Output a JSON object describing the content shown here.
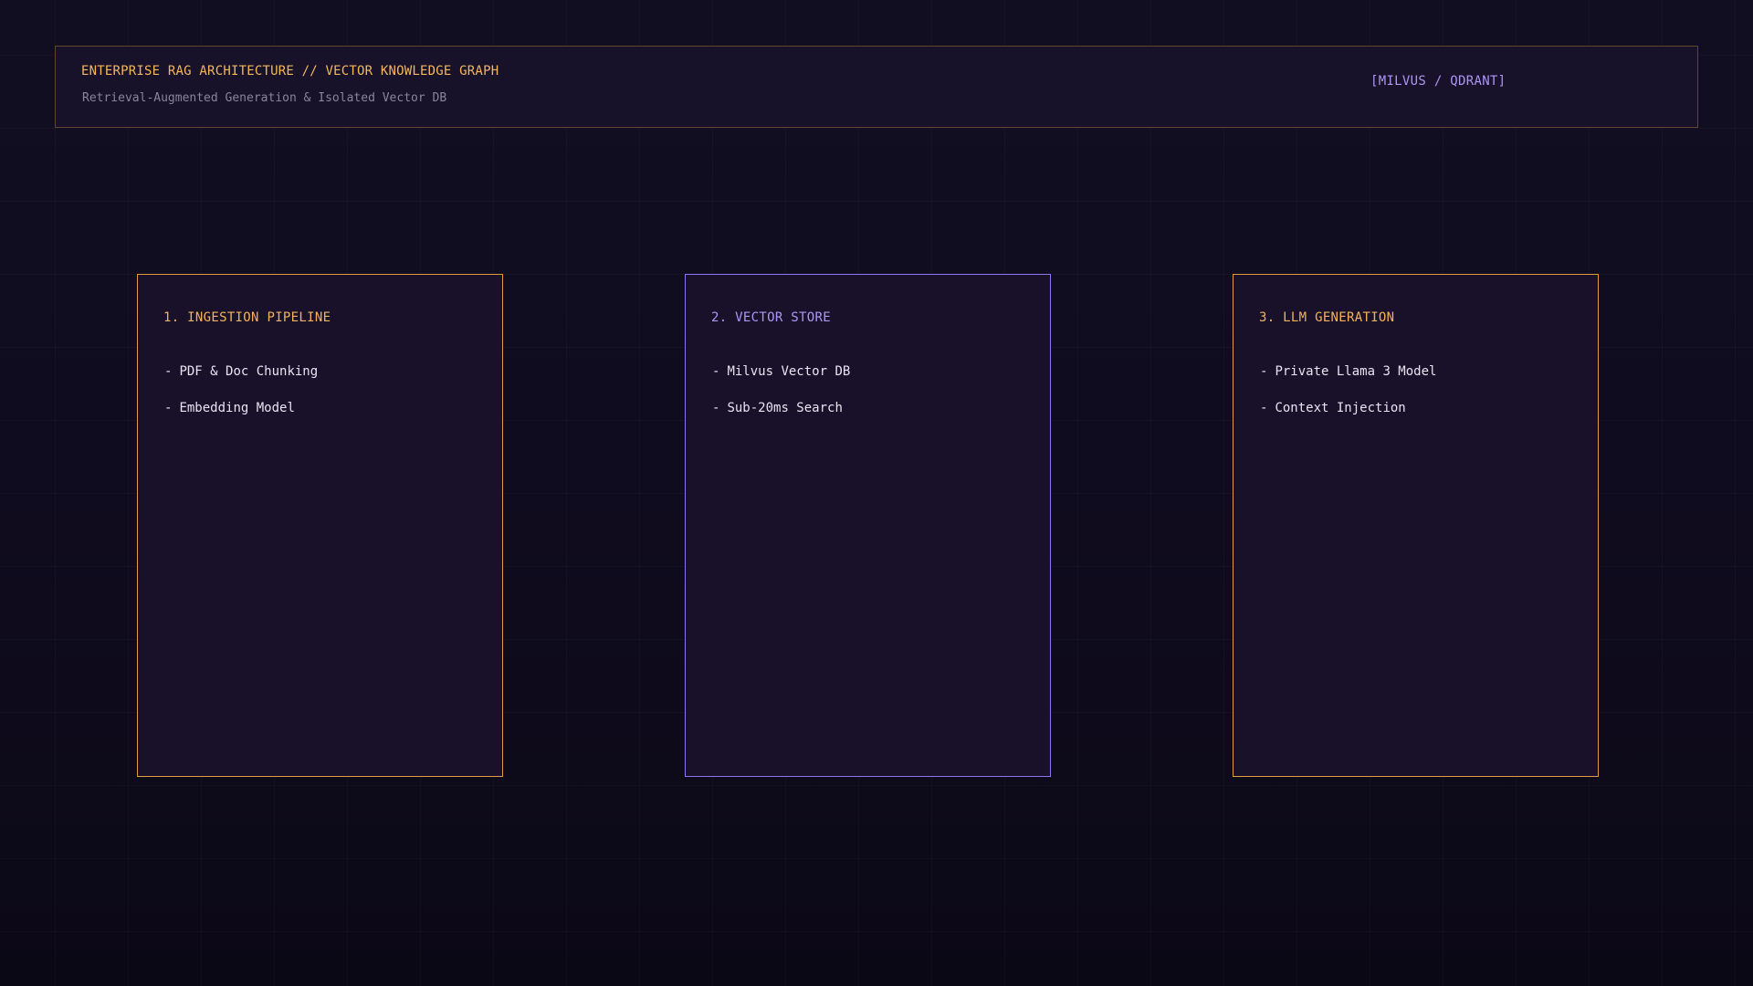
{
  "header": {
    "title": "ENTERPRISE RAG ARCHITECTURE // VECTOR KNOWLEDGE GRAPH",
    "subtitle": "Retrieval-Augmented Generation & Isolated Vector DB",
    "tag": "[MILVUS / QDRANT]"
  },
  "colors": {
    "background": "#0f0b1d",
    "panel": "#181129",
    "accent_orange": "#f3b35c",
    "accent_purple": "#ab98f5",
    "text": "#e8e4f2",
    "muted": "#8a8598"
  },
  "stages": [
    {
      "title": "1. INGESTION PIPELINE",
      "accent": "orange",
      "items": [
        "PDF & Doc Chunking",
        "Embedding Model"
      ]
    },
    {
      "title": "2. VECTOR STORE",
      "accent": "purple",
      "items": [
        "Milvus Vector DB",
        "Sub-20ms Search"
      ]
    },
    {
      "title": "3. LLM GENERATION",
      "accent": "orange",
      "items": [
        "Private Llama 3 Model",
        "Context Injection"
      ]
    }
  ]
}
